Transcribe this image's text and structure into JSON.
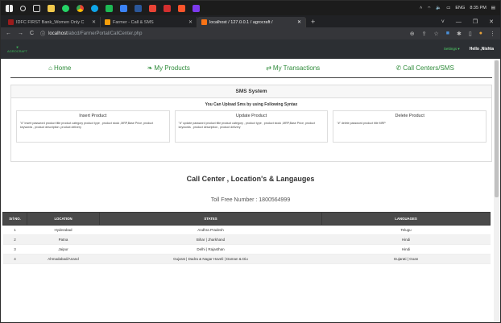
{
  "taskbar": {
    "icons": [
      "windows-start",
      "search",
      "task-view",
      "file-explorer",
      "whatsapp",
      "chrome",
      "edge",
      "media",
      "settings",
      "word",
      "gmail",
      "jira",
      "brave",
      "vs-code"
    ],
    "tray": {
      "lang": "ENG",
      "time": "8:35 PM"
    }
  },
  "browser": {
    "tabs": [
      {
        "label": "IDFC FIRST Bank_Women Only C",
        "active": false
      },
      {
        "label": "Farmer - Call & SMS",
        "active": false
      },
      {
        "label": "localhost / 127.0.0.1 / agrocraft /",
        "active": true
      }
    ],
    "url_host": "localhost",
    "url_path": "/abcd/FarmerPortal/CallCenter.php"
  },
  "site": {
    "logo_text": "AGROCRAFT",
    "settings_label": "Settings ▾",
    "greeting": "Hello ,Nishta"
  },
  "nav": {
    "home": "Home",
    "products": "My Products",
    "transactions": "My Transactions",
    "callcenters": "Call Centers/SMS"
  },
  "sms": {
    "title": "SMS System",
    "subtitle": "You Can Upload Sms by using Following Syntax",
    "cards": [
      {
        "title": "Insert Product",
        "text": "\"#\" insert password product title product category product type , product stock ,MRP,Base Price, product keywords , product description ,product delivery"
      },
      {
        "title": "Update Product",
        "text": "\"#\" update password product title product category , product type , product stock ,MRP,Base Price, product keywords , product description , product delivery"
      },
      {
        "title": "Delete Product",
        "text": "\"#\" delete password product title MRP"
      }
    ]
  },
  "callcenter": {
    "title": "Call Center , Location's & Langauges",
    "tollfree": "Toll Free Number : 1800564999",
    "headers": [
      "Srl NO.",
      "LOCATION",
      "STATES",
      "LANGUAGES"
    ],
    "rows": [
      [
        "1",
        "Hyderabad",
        "Andhra Pradesh",
        "Telugu"
      ],
      [
        "2",
        "Patna",
        "Bihar | Jharkhand",
        "Hindi"
      ],
      [
        "3",
        "Jaipur",
        "Delhi | Rajasthan",
        "Hindi"
      ],
      [
        "4",
        "Ahmadabad/Anand",
        "Gujarat | Dadra & Nagar Haveli | Daman & Diu",
        "Gujarati | Goan"
      ]
    ]
  }
}
